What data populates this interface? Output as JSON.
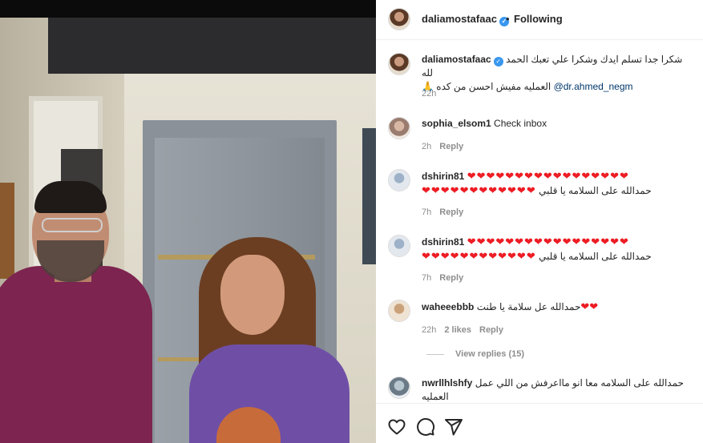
{
  "header": {
    "username": "daliamostafaac",
    "separator": "•",
    "follow_state": "Following"
  },
  "comments": [
    {
      "username": "daliamostafaac",
      "text": "شكرا جدا تسلم ايدك وشكرا علي تعبك الحمد لله",
      "text2": "العمليه مفيش احسن من كده 🙏",
      "mention": "@dr.ahmed_negm",
      "time": "22h"
    },
    {
      "username": "sophia_elsom1",
      "text": "Check inbox",
      "time": "2h",
      "reply": "Reply"
    },
    {
      "username": "dshirin81",
      "hearts": "❤❤❤❤❤❤❤❤❤❤❤❤❤❤❤❤❤",
      "hearts2": "❤❤❤❤❤❤❤❤❤❤❤❤",
      "text": "حمدالله على السلامه يا قلبي",
      "time": "7h",
      "reply": "Reply"
    },
    {
      "username": "dshirin81",
      "hearts": "❤❤❤❤❤❤❤❤❤❤❤❤❤❤❤❤❤",
      "hearts2": "❤❤❤❤❤❤❤❤❤❤❤❤",
      "text": "حمدالله على السلامه يا قلبي",
      "time": "7h",
      "reply": "Reply"
    },
    {
      "username": "waheeebbb",
      "text": "حمدالله عل سلامة يا طنت",
      "hearts": "❤❤",
      "time": "22h",
      "likes": "2 likes",
      "reply": "Reply",
      "view_replies": "View replies (15)"
    },
    {
      "username": "nwrllhlshfy",
      "text": "حمدالله على السلامه معا انو مااعرفش من اللي عمل",
      "text2": "العمليه"
    }
  ],
  "actions": {
    "like_icon": "heart-icon",
    "comment_icon": "comment-icon",
    "share_icon": "share-icon"
  },
  "colors": {
    "accent": "#3897f0",
    "mention": "#00376b",
    "heart": "#ed1c24",
    "meta": "#8e8e8e"
  }
}
